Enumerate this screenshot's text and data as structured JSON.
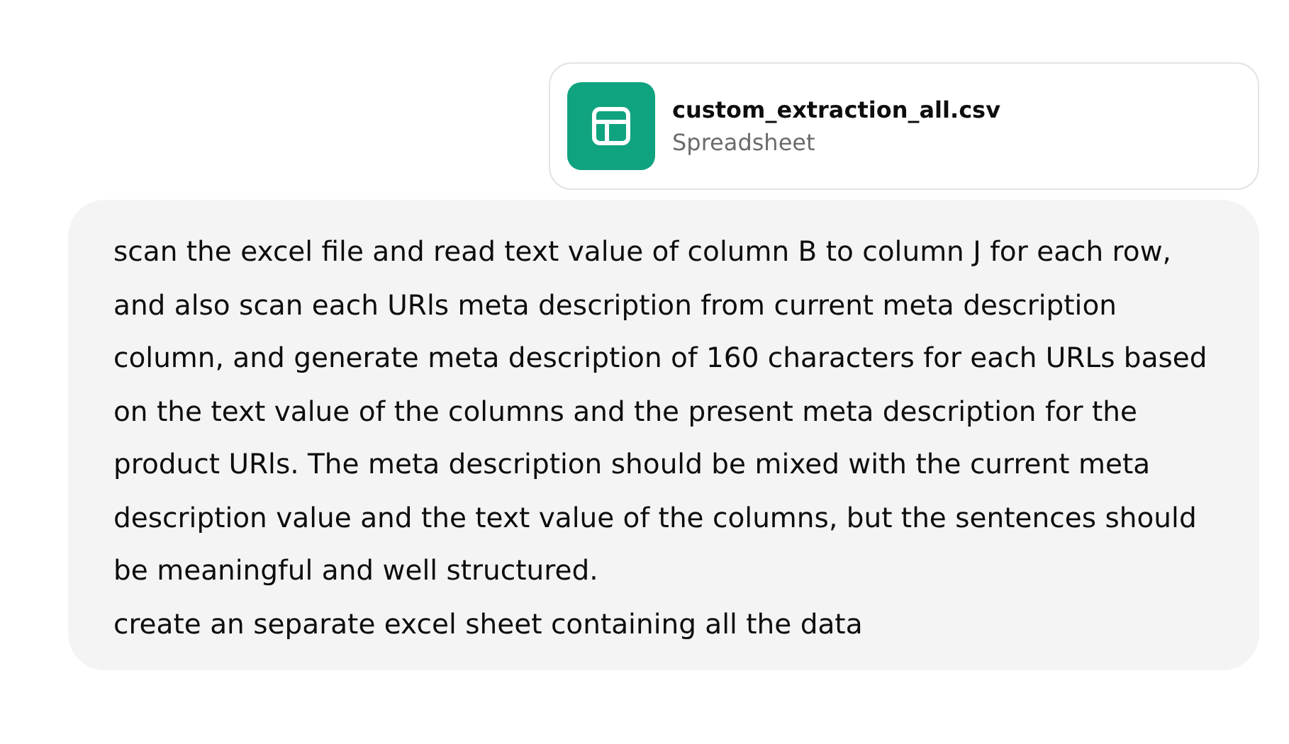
{
  "attachment": {
    "file_name": "custom_extraction_all.csv",
    "file_type": "Spreadsheet"
  },
  "message": {
    "paragraphs": [
      "scan the excel file and read text value of column B to column J for each row, and also scan each URls meta description from current meta description column, and generate meta description of 160 characters for each URLs based on the text value of the columns and the present meta description for the product URls. The meta description should be mixed with the current meta description value and the text value of the columns, but the sentences should be meaningful and well structured.",
      "create an separate excel sheet containing all the data"
    ]
  }
}
